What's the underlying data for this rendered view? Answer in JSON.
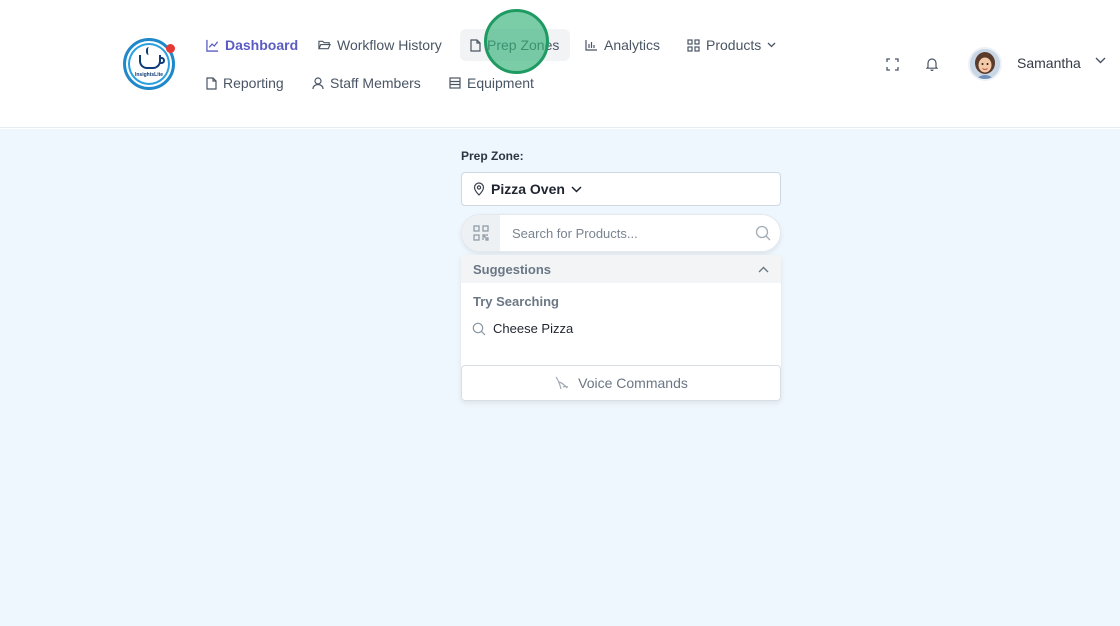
{
  "app": {
    "logo_text": "InsightsLite"
  },
  "nav": {
    "items": [
      {
        "label": "Dashboard",
        "icon": "chart-line-icon"
      },
      {
        "label": "Workflow History",
        "icon": "folder-open-icon"
      },
      {
        "label": "Prep Zones",
        "icon": "file-icon"
      },
      {
        "label": "Analytics",
        "icon": "bar-chart-icon"
      },
      {
        "label": "Products",
        "icon": "grid-icon"
      },
      {
        "label": "Reporting",
        "icon": "file-icon"
      },
      {
        "label": "Staff Members",
        "icon": "user-icon"
      },
      {
        "label": "Equipment",
        "icon": "list-icon"
      }
    ]
  },
  "user": {
    "name": "Samantha"
  },
  "prep_zone": {
    "label": "Prep Zone:",
    "selected": "Pizza Oven"
  },
  "search": {
    "placeholder": "Search for Products..."
  },
  "suggestions": {
    "header": "Suggestions",
    "try_label": "Try Searching",
    "items": [
      "Cheese Pizza"
    ],
    "voice_label": "Voice Commands"
  },
  "colors": {
    "accent": "#5b5bc4",
    "main_bg": "#eef7fd",
    "cursor": "#34b278"
  }
}
